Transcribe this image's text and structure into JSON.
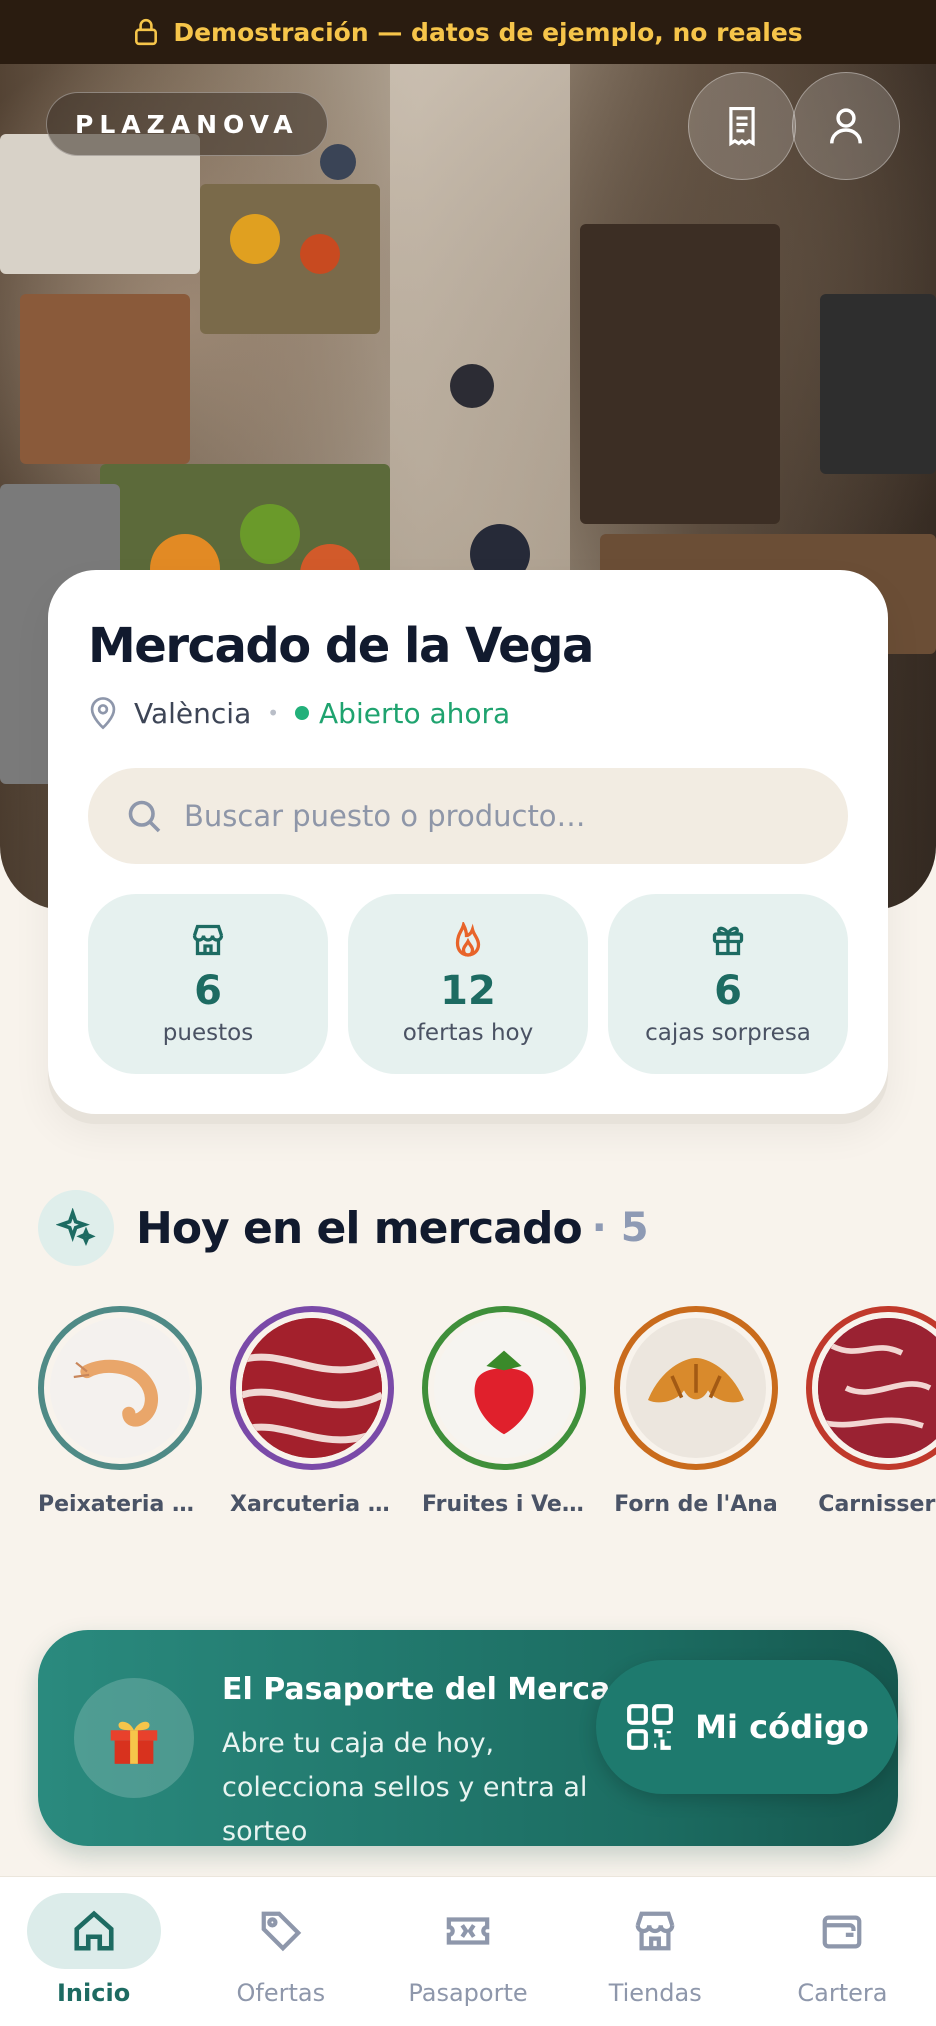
{
  "banner": {
    "text": "Demostración — datos de ejemplo, no reales",
    "icon": "lock-icon"
  },
  "header": {
    "brand": "PLAZANOVA",
    "receipt_icon": "receipt-icon",
    "profile_icon": "user-icon"
  },
  "market": {
    "name": "Mercado de la Vega",
    "city": "València",
    "status": "Abierto ahora",
    "search_placeholder": "Buscar puesto o producto…"
  },
  "stats": [
    {
      "icon": "store-icon",
      "value": "6",
      "label": "puestos"
    },
    {
      "icon": "flame-icon",
      "value": "12",
      "label": "ofertas hoy"
    },
    {
      "icon": "gift-icon",
      "value": "6",
      "label": "cajas sorpresa"
    }
  ],
  "today": {
    "title": "Hoy en el mercado",
    "count": "· 5",
    "stores": [
      {
        "name": "Peixateria E...",
        "ring": "#4f8a86"
      },
      {
        "name": "Xarcuteria i ...",
        "ring": "#7a4aa8"
      },
      {
        "name": "Fruites i Ver...",
        "ring": "#3f8f3a"
      },
      {
        "name": "Forn de l'Ana",
        "ring": "#c96b1c"
      },
      {
        "name": "Carnisseria",
        "ring": "#c0392b"
      }
    ]
  },
  "passport": {
    "title": "El Pasaporte del Mercado",
    "description": "Abre tu caja de hoy, colecciona sellos y entra al sorteo",
    "button_label": "Mi código"
  },
  "tabs": [
    {
      "label": "Inicio",
      "icon": "home-icon",
      "active": true
    },
    {
      "label": "Ofertas",
      "icon": "tag-icon",
      "active": false
    },
    {
      "label": "Pasaporte",
      "icon": "ticket-icon",
      "active": false
    },
    {
      "label": "Tiendas",
      "icon": "store-icon",
      "active": false
    },
    {
      "label": "Cartera",
      "icon": "wallet-icon",
      "active": false
    }
  ],
  "colors": {
    "accent": "#1d6b62",
    "open": "#1fa36f",
    "banner_text": "#f6c54a",
    "flame": "#e8642a"
  }
}
